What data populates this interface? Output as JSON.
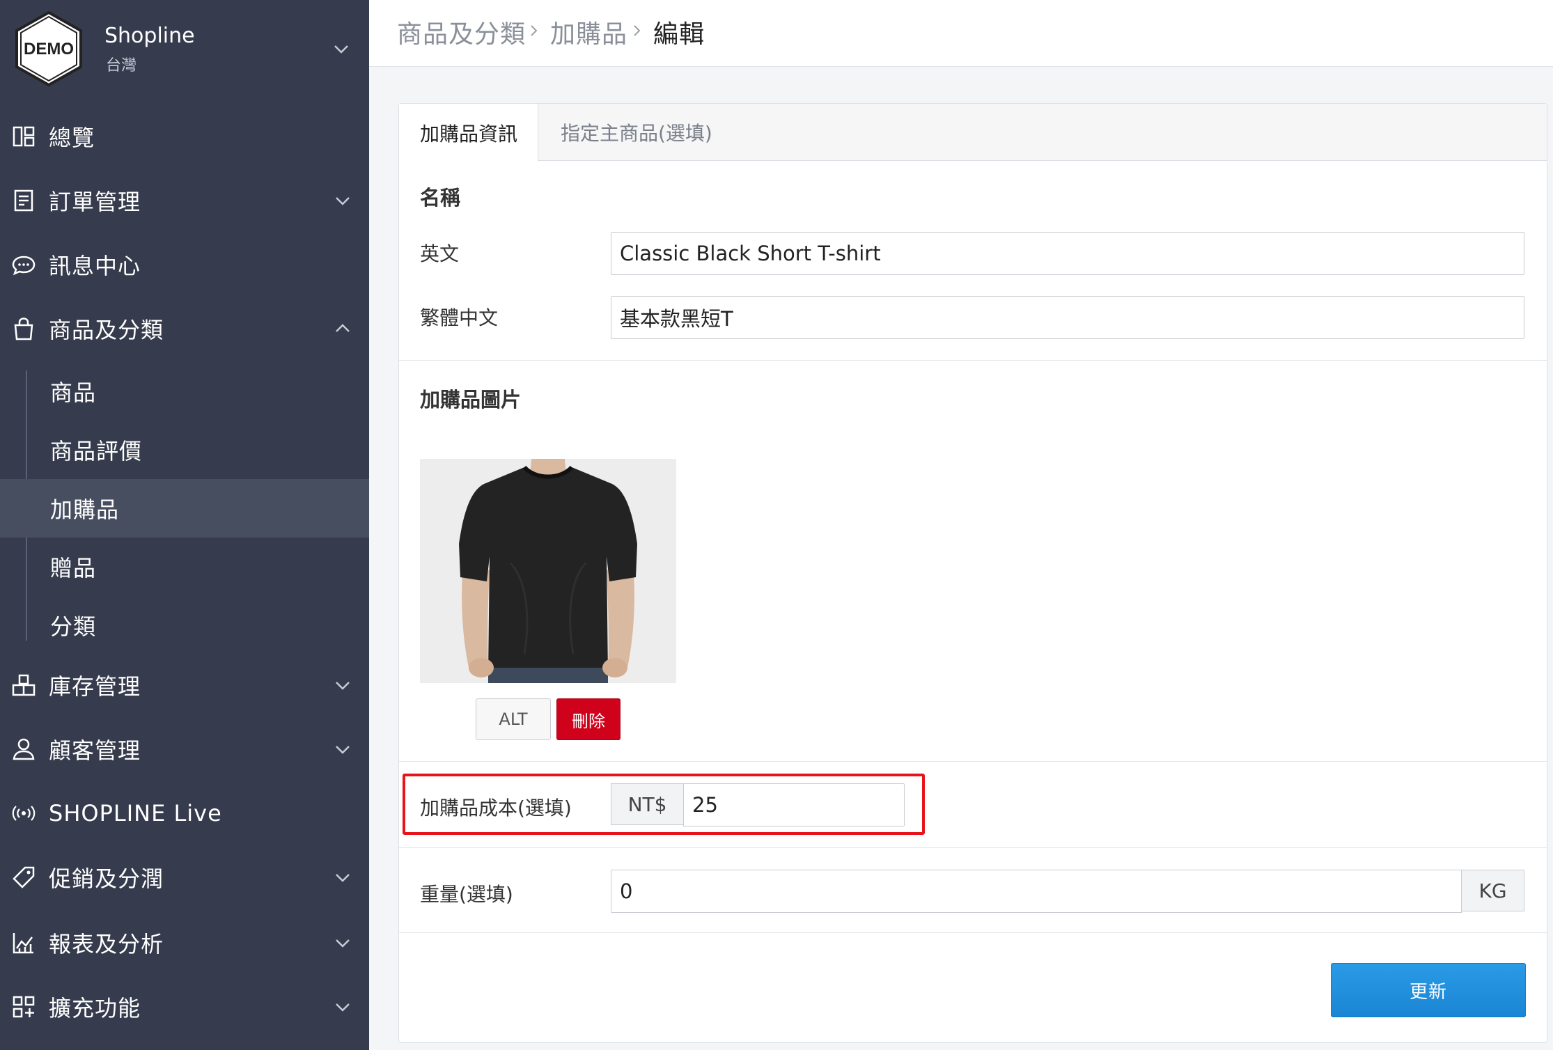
{
  "store": {
    "logo_text": "DEMO",
    "name": "Shopline",
    "region": "台灣"
  },
  "sidebar": {
    "items": [
      {
        "label": "總覽",
        "icon": "dashboard-icon"
      },
      {
        "label": "訂單管理",
        "icon": "orders-icon"
      },
      {
        "label": "訊息中心",
        "icon": "chat-icon"
      },
      {
        "label": "商品及分類",
        "icon": "shopping-bag-icon"
      },
      {
        "label": "庫存管理",
        "icon": "inventory-icon"
      },
      {
        "label": "顧客管理",
        "icon": "user-icon"
      },
      {
        "label": "SHOPLINE Live",
        "icon": "broadcast-icon"
      },
      {
        "label": "促銷及分潤",
        "icon": "tag-icon"
      },
      {
        "label": "報表及分析",
        "icon": "chart-icon"
      },
      {
        "label": "擴充功能",
        "icon": "apps-icon"
      }
    ],
    "sub_items": [
      {
        "label": "商品"
      },
      {
        "label": "商品評價"
      },
      {
        "label": "加購品"
      },
      {
        "label": "贈品"
      },
      {
        "label": "分類"
      }
    ],
    "active_sub_item": "加購品"
  },
  "breadcrumb": {
    "items": [
      "商品及分類",
      "加購品",
      "編輯"
    ]
  },
  "tabs": [
    {
      "label": "加購品資訊"
    },
    {
      "label": "指定主商品(選填)"
    }
  ],
  "form": {
    "name_section_title": "名稱",
    "english_label": "英文",
    "english_value": "Classic Black Short T-shirt",
    "chinese_label": "繁體中文",
    "chinese_value": "基本款黑短T",
    "image_section_title": "加購品圖片",
    "alt_button": "ALT",
    "delete_button": "刪除",
    "cost_label": "加購品成本(選填)",
    "cost_currency": "NT$",
    "cost_value": "25",
    "weight_label": "重量(選填)",
    "weight_value": "0",
    "weight_unit": "KG",
    "update_button": "更新"
  },
  "colors": {
    "sidebar_bg": "#363c4d",
    "sidebar_active": "#474e60",
    "highlight": "#e8141c",
    "delete": "#d0021b",
    "primary": "#1a85d4"
  }
}
